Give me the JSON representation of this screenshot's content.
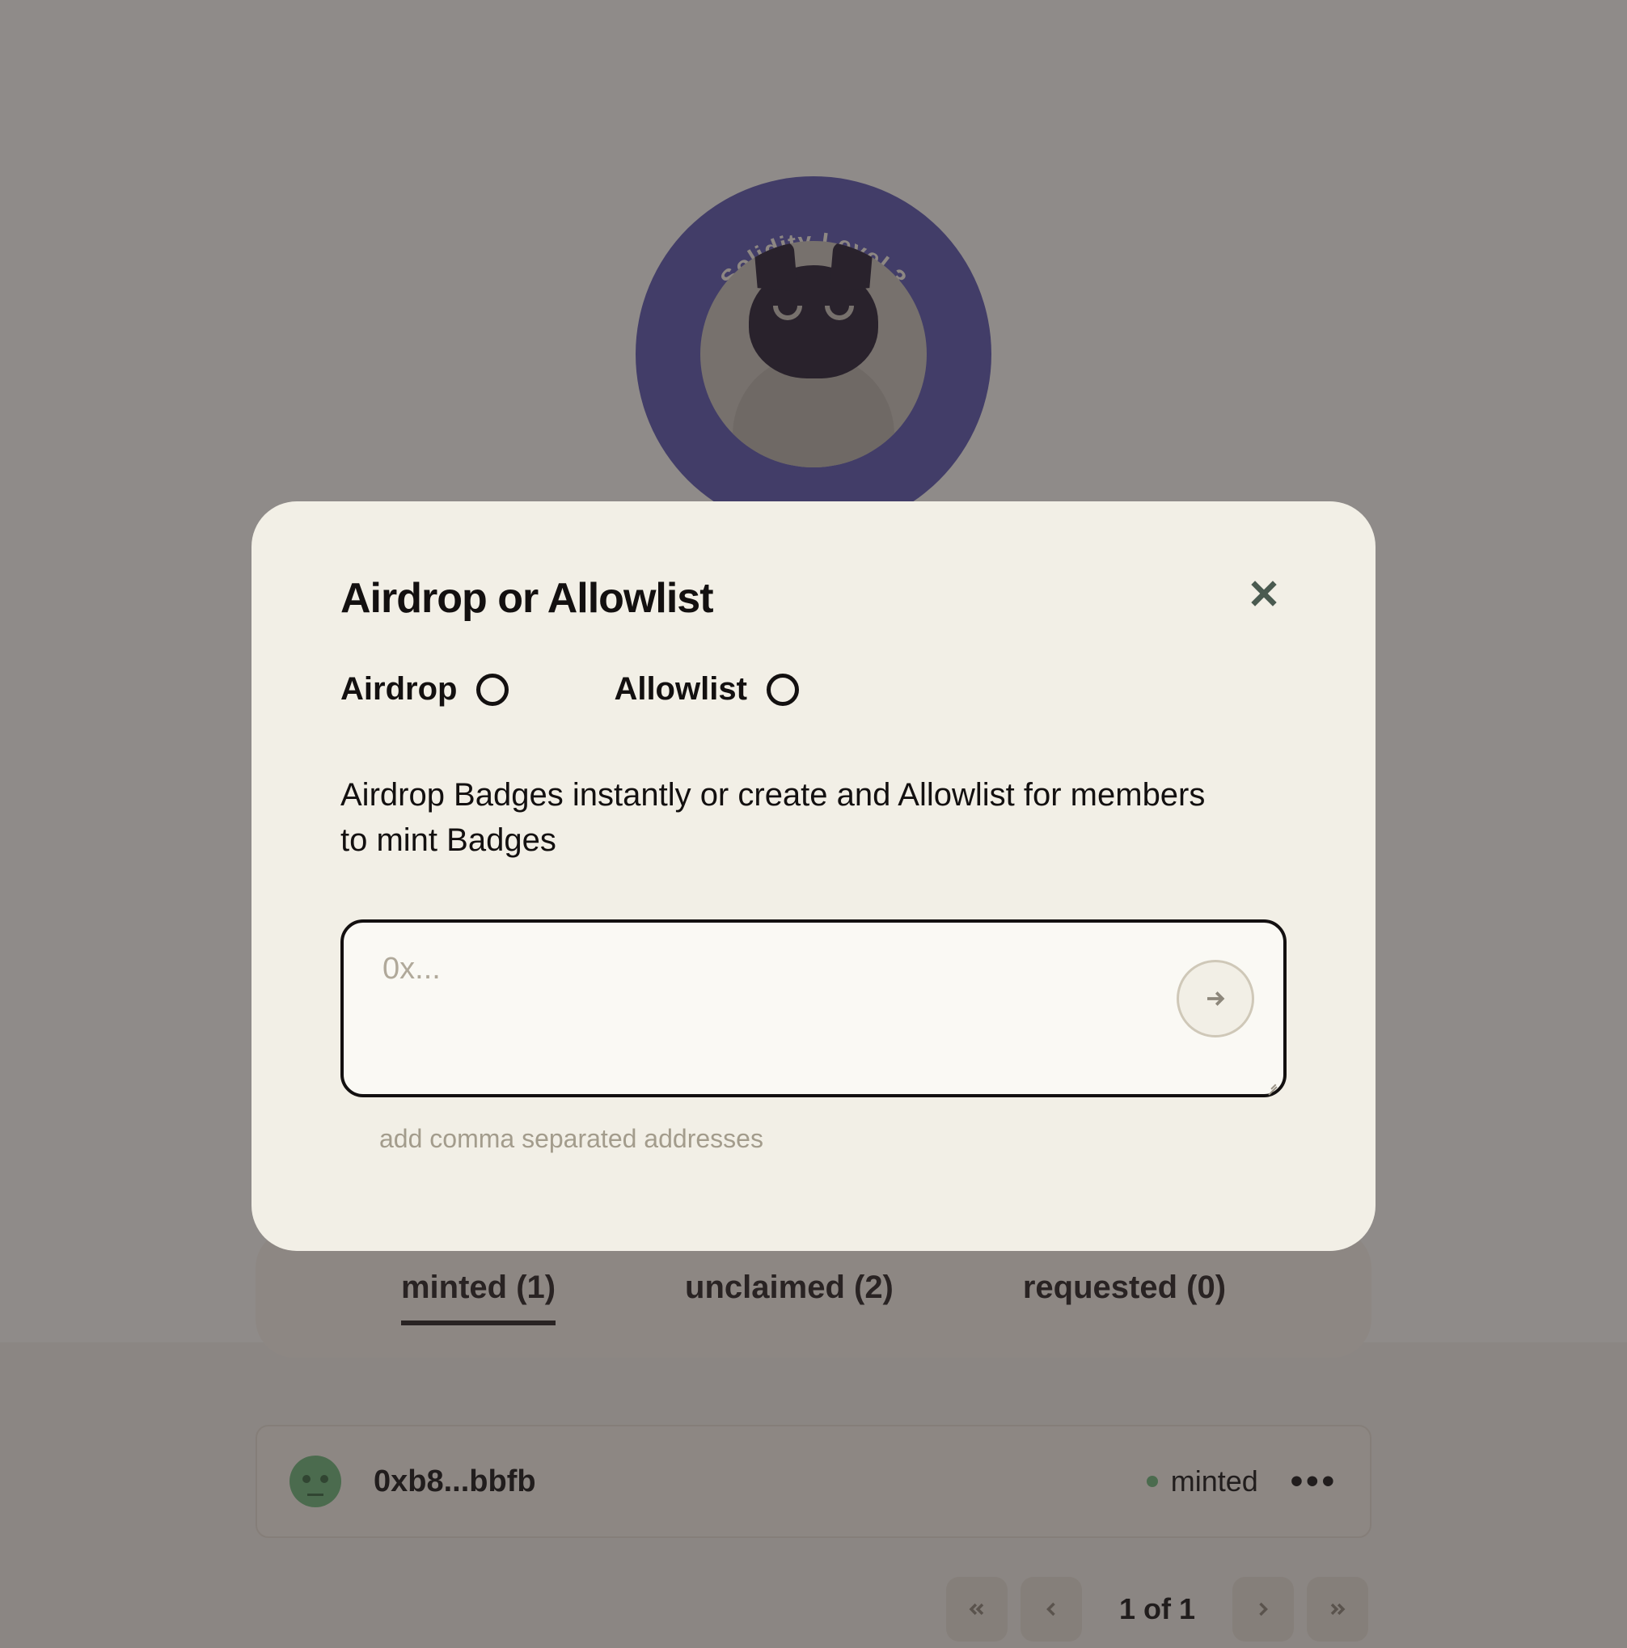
{
  "badge": {
    "ring_text": "Solidity Level 3"
  },
  "modal": {
    "title": "Airdrop or Allowlist",
    "options": {
      "airdrop_label": "Airdrop",
      "allowlist_label": "Allowlist"
    },
    "description": "Airdrop Badges instantly or create and Allowlist for members to mint Badges",
    "input_placeholder": "0x...",
    "input_hint": "add comma separated addresses"
  },
  "tabs": {
    "minted": "minted (1)",
    "unclaimed": "unclaimed (2)",
    "requested": "requested (0)"
  },
  "list": {
    "items": [
      {
        "address": "0xb8...bbfb",
        "status": "minted"
      }
    ]
  },
  "pagination": {
    "text": "1 of 1"
  }
}
